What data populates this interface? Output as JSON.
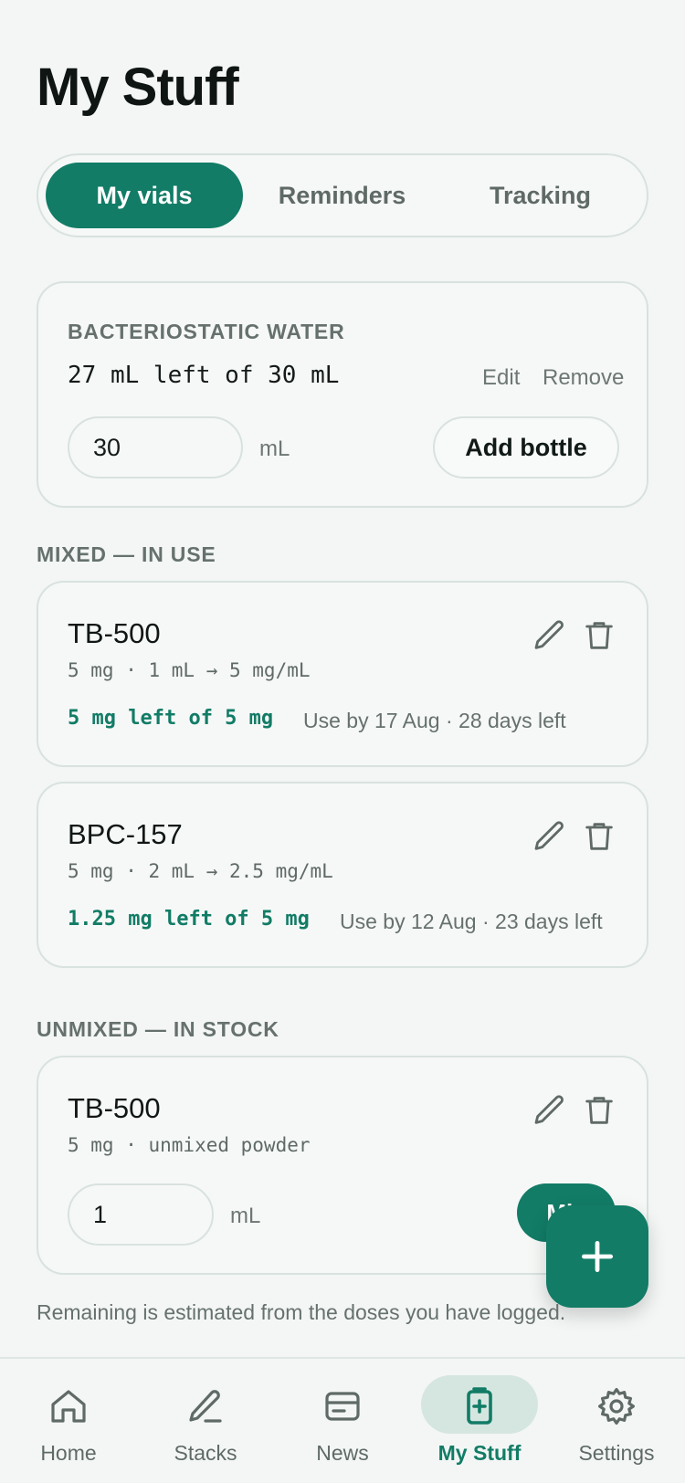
{
  "page": {
    "title": "My Stuff"
  },
  "tabs": [
    {
      "label": "My vials",
      "active": true
    },
    {
      "label": "Reminders",
      "active": false
    },
    {
      "label": "Tracking",
      "active": false
    }
  ],
  "water": {
    "heading": "BACTERIOSTATIC WATER",
    "remaining": "27 mL left of 30 mL",
    "edit_label": "Edit",
    "remove_label": "Remove",
    "input_value": "30",
    "unit": "mL",
    "add_label": "Add bottle"
  },
  "mixed": {
    "heading": "MIXED — IN USE",
    "items": [
      {
        "name": "TB-500",
        "meta": "5 mg · 1 mL → 5 mg/mL",
        "remaining": "5 mg left of 5 mg",
        "use_by": "Use by 17 Aug · 28 days left"
      },
      {
        "name": "BPC-157",
        "meta": "5 mg · 2 mL → 2.5 mg/mL",
        "remaining": "1.25 mg left of 5 mg",
        "use_by": "Use by 12 Aug · 23 days left"
      }
    ]
  },
  "unmixed": {
    "heading": "UNMIXED — IN STOCK",
    "items": [
      {
        "name": "TB-500",
        "meta": "5 mg · unmixed powder",
        "input_value": "1",
        "unit": "mL",
        "mix_label": "Mix"
      }
    ]
  },
  "footnote": "Remaining is estimated from the doses you have logged.",
  "nav": [
    {
      "label": "Home",
      "icon": "home-icon",
      "active": false
    },
    {
      "label": "Stacks",
      "icon": "pencil-icon",
      "active": false
    },
    {
      "label": "News",
      "icon": "card-icon",
      "active": false
    },
    {
      "label": "My Stuff",
      "icon": "vial-plus-icon",
      "active": true
    },
    {
      "label": "Settings",
      "icon": "gear-icon",
      "active": false
    }
  ],
  "colors": {
    "accent": "#127c66",
    "accent_soft": "#d5e6e0",
    "background": "#f3f6f5"
  }
}
